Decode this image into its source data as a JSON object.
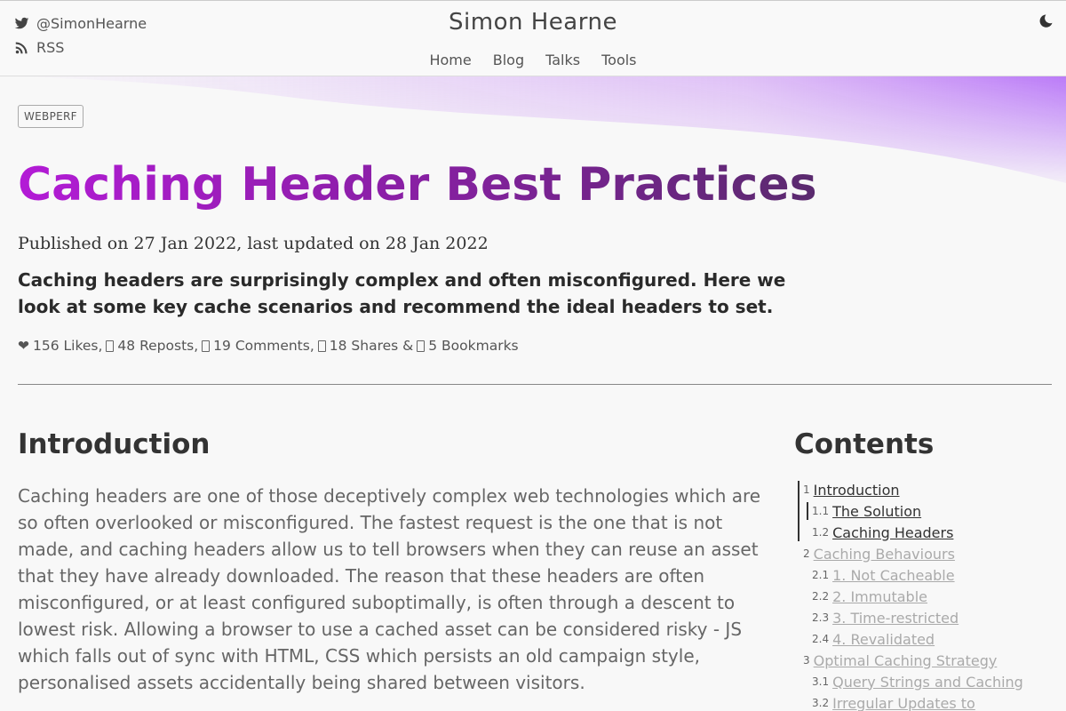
{
  "header": {
    "twitter_handle": "@SimonHearne",
    "rss_label": "RSS",
    "site_title": "Simon Hearne",
    "nav": [
      {
        "label": "Home"
      },
      {
        "label": "Blog"
      },
      {
        "label": "Talks"
      },
      {
        "label": "Tools"
      }
    ],
    "theme_icon": "moon-icon"
  },
  "post": {
    "tag": "WEBPERF",
    "title": "Caching Header Best Practices",
    "published": "Published on 27 Jan 2022, last updated on 28 Jan 2022",
    "lead": "Caching headers are surprisingly complex and often misconfigured. Here we look at some key cache scenarios and recommend the ideal headers to set.",
    "reactions": {
      "likes": "156 Likes,",
      "reposts": "48 Reposts,",
      "comments": "19 Comments,",
      "shares": "18 Shares &",
      "bookmarks": "5 Bookmarks"
    }
  },
  "content": {
    "heading": "Introduction",
    "paragraph": "Caching headers are one of those deceptively complex web technologies which are so often overlooked or misconfigured. The fastest request is the one that is not made, and caching headers allow us to tell browsers when they can reuse an asset that they have already downloaded. The reason that these headers are often misconfigured, or at least configured suboptimally, is often through a descent to lowest risk. Allowing a browser to use a cached asset can be considered risky - JS which falls out of sync with HTML, CSS which persists an old campaign style, personalised assets accidentally being shared between visitors."
  },
  "toc": {
    "heading": "Contents",
    "items": [
      {
        "num": "1",
        "label": "Introduction",
        "level": 1,
        "active": true
      },
      {
        "num": "1.1",
        "label": "The Solution",
        "level": 2,
        "active": true
      },
      {
        "num": "1.2",
        "label": "Caching Headers",
        "level": 2,
        "active": true
      },
      {
        "num": "2",
        "label": "Caching Behaviours",
        "level": 1,
        "active": false
      },
      {
        "num": "2.1",
        "label": "1. Not Cacheable",
        "level": 2,
        "active": false
      },
      {
        "num": "2.2",
        "label": "2. Immutable",
        "level": 2,
        "active": false
      },
      {
        "num": "2.3",
        "label": "3. Time-restricted",
        "level": 2,
        "active": false
      },
      {
        "num": "2.4",
        "label": "4. Revalidated",
        "level": 2,
        "active": false
      },
      {
        "num": "3",
        "label": "Optimal Caching Strategy",
        "level": 1,
        "active": false
      },
      {
        "num": "3.1",
        "label": "Query Strings and Caching",
        "level": 2,
        "active": false
      },
      {
        "num": "3.2",
        "label": "Irregular Updates to",
        "level": 2,
        "active": false
      }
    ]
  }
}
